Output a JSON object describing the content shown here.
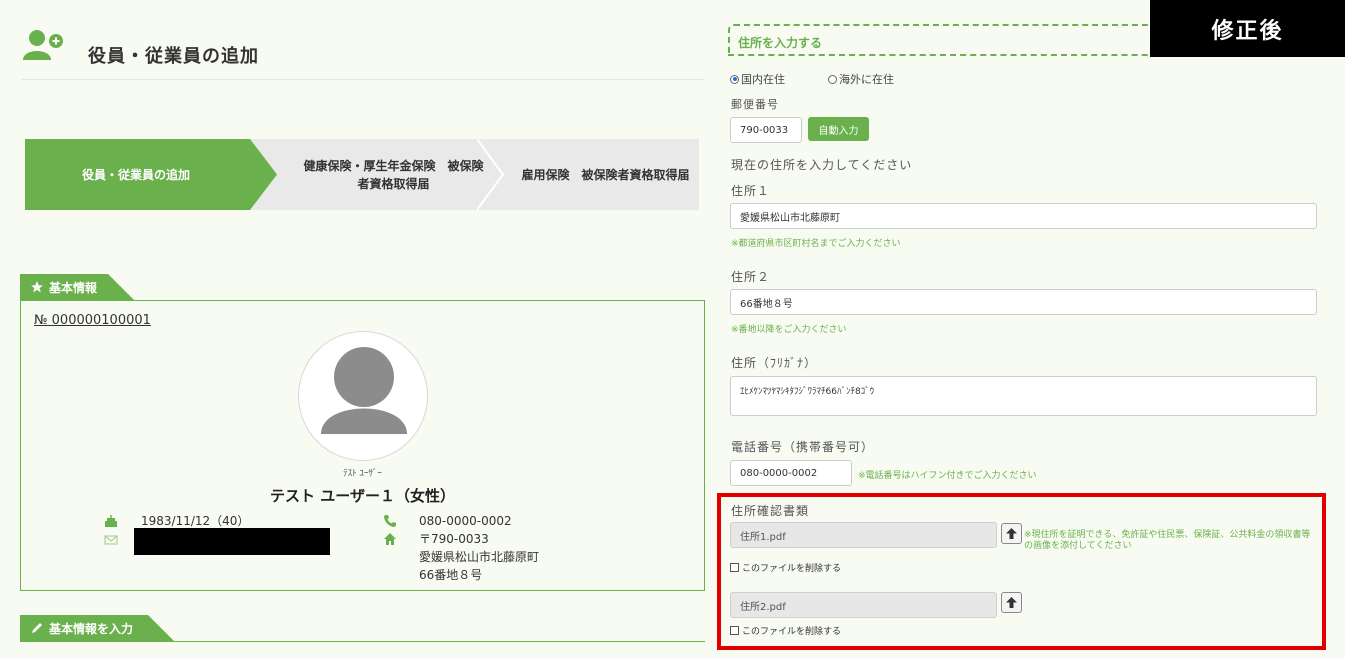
{
  "header": {
    "title": "役員・従業員の追加",
    "icon": "user-add-icon"
  },
  "steps": [
    {
      "label": "役員・従業員の追加",
      "active": true
    },
    {
      "label_line1": "健康保険・厚生年金保険　被保険",
      "label_line2": "者資格取得届",
      "active": false
    },
    {
      "label": "雇用保険　被保険者資格取得届",
      "active": false
    }
  ],
  "basic_info": {
    "tab_label": "基本情報",
    "tab_icon": "star-icon",
    "number": "№ 000000100001",
    "kana": "ﾃｽﾄ ﾕｰｻﾞｰ",
    "name": "テスト ユーザー１（女性）",
    "birth": "1983/11/12（40）",
    "phone": "080-0000-0002",
    "postal": "〒790-0033",
    "address1": "愛媛県松山市北藤原町",
    "address2": "66番地８号"
  },
  "input_section": {
    "tab_label": "基本情報を入力",
    "tab_icon": "pencil-icon"
  },
  "badge": "修正後",
  "form": {
    "address_header": "住所を入力する",
    "radio_domestic": "国内在住",
    "radio_overseas": "海外に在住",
    "postal_label": "郵便番号",
    "postal_value": "790-0033",
    "auto_button": "自動入力",
    "current_addr_prompt": "現在の住所を入力してください",
    "addr1_label": "住所１",
    "addr1_value": "愛媛県松山市北藤原町",
    "addr1_note": "※都道府県市区町村名までご入力ください",
    "addr2_label": "住所２",
    "addr2_value": "66番地８号",
    "addr2_note": "※番地以降をご入力ください",
    "kana_label": "住所（ﾌﾘｶﾞﾅ）",
    "kana_value": "ｴﾋﾒｹﾝﾏﾂﾔﾏｼｷﾀﾌｼﾞﾜﾗﾏﾁ66ﾊﾞﾝﾁ8ｺﾞｳ",
    "tel_label": "電話番号（携帯番号可）",
    "tel_value": "080-0000-0002",
    "tel_note": "※電話番号はハイフン付きでご入力ください",
    "doc_label": "住所確認書類",
    "file1": "住所1.pdf",
    "file2": "住所2.pdf",
    "doc_note_line1": "※現住所を証明できる、免許証や住民票、保険証、公共料金の領収書等",
    "doc_note_line2": "の画像を添付してください",
    "delete_label": "このファイルを削除する"
  },
  "colors": {
    "accent": "#6ab04c",
    "highlight": "#e00000"
  }
}
